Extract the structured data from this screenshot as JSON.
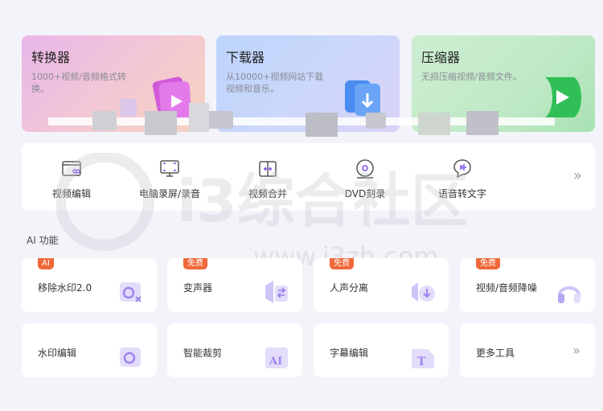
{
  "top_cards": [
    {
      "title": "转换器",
      "desc": "1000+视频/音频格式转换。"
    },
    {
      "title": "下载器",
      "desc": "从10000+视频网站下载视频和音乐。"
    },
    {
      "title": "压缩器",
      "desc": "无损压缩视频/音频文件。"
    }
  ],
  "quick_tools": [
    {
      "label": "视频编辑",
      "icon": "video-edit-icon"
    },
    {
      "label": "电脑录屏/录音",
      "icon": "screen-record-icon"
    },
    {
      "label": "视频合并",
      "icon": "video-merge-icon"
    },
    {
      "label": "DVD刻录",
      "icon": "dvd-burn-icon"
    },
    {
      "label": "语音转文字",
      "icon": "speech-to-text-icon"
    }
  ],
  "quick_more": "»",
  "section_title": "AI 功能",
  "tools": [
    {
      "label": "移除水印2.0",
      "badge": "AI",
      "badge_color": "#f0683a"
    },
    {
      "label": "变声器",
      "badge": "免费",
      "badge_color": "#f0683a"
    },
    {
      "label": "人声分离",
      "badge": "免费",
      "badge_color": "#f0683a"
    },
    {
      "label": "视频/音频降噪",
      "badge": "免费",
      "badge_color": "#f0683a"
    },
    {
      "label": "水印编辑"
    },
    {
      "label": "智能裁剪"
    },
    {
      "label": "字幕编辑"
    },
    {
      "label": "更多工具"
    }
  ],
  "more_tools_arrow": "»",
  "watermark": {
    "text": "i3综合社区",
    "url": "www.i3zh.com"
  }
}
